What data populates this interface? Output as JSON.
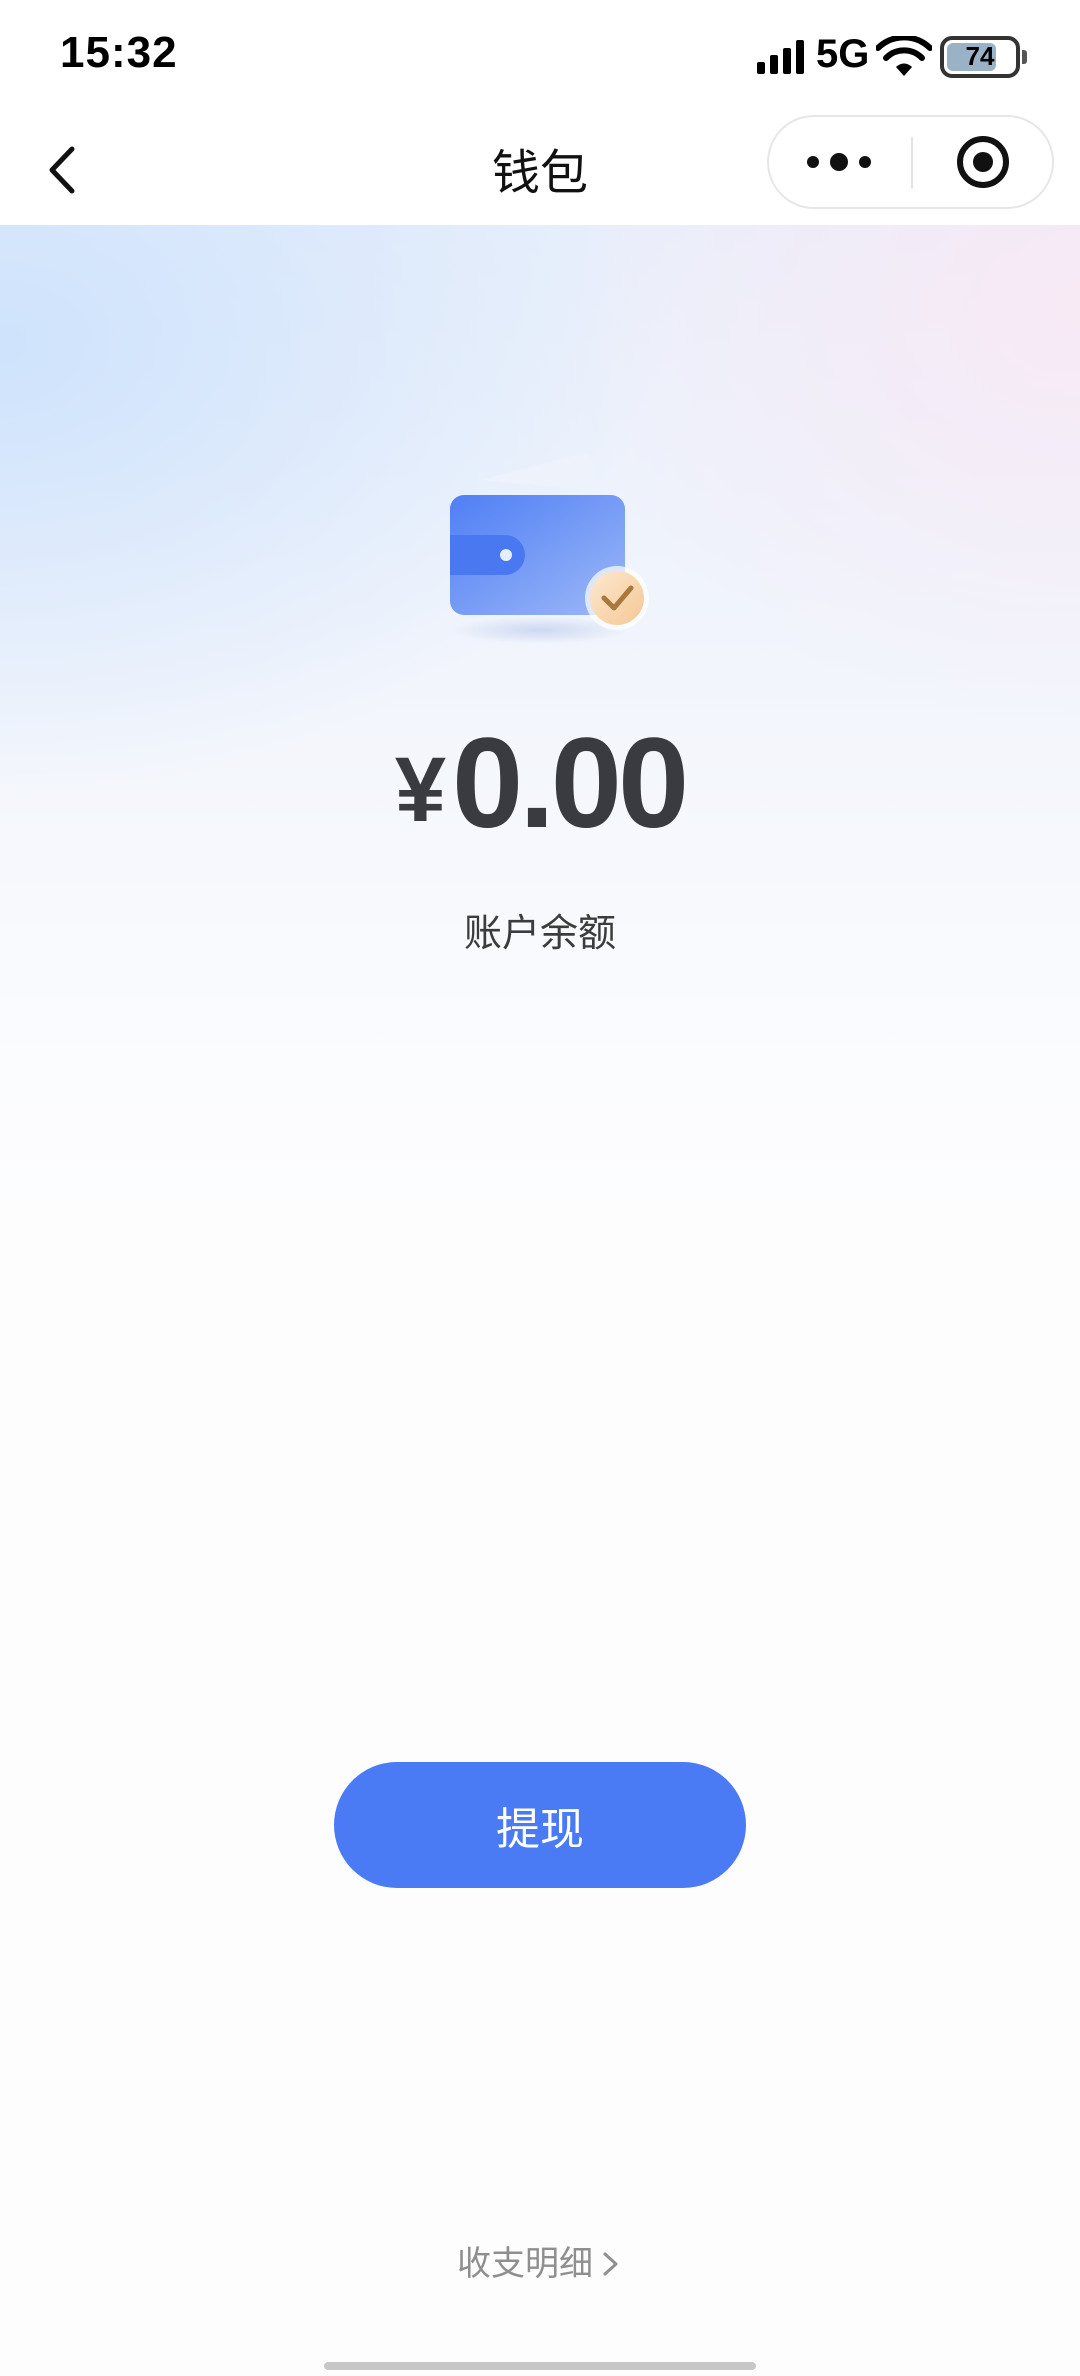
{
  "status_bar": {
    "time": "15:32",
    "network": "5G",
    "battery": "74",
    "battery_level": 0.74
  },
  "nav": {
    "title": "钱包"
  },
  "wallet": {
    "currency_symbol": "¥",
    "balance": "0.00",
    "balance_label": "账户余额"
  },
  "actions": {
    "withdraw_label": "提现",
    "details_label": "收支明细"
  },
  "colors": {
    "accent": "#4a7bf5",
    "text_primary": "#3a3b40",
    "text_secondary": "#8f8f8f"
  },
  "icons": [
    "back-chevron-icon",
    "more-dots-icon",
    "close-target-icon",
    "wallet-icon",
    "check-badge-icon",
    "chevron-right-icon",
    "signal-icon",
    "wifi-icon",
    "battery-icon"
  ]
}
